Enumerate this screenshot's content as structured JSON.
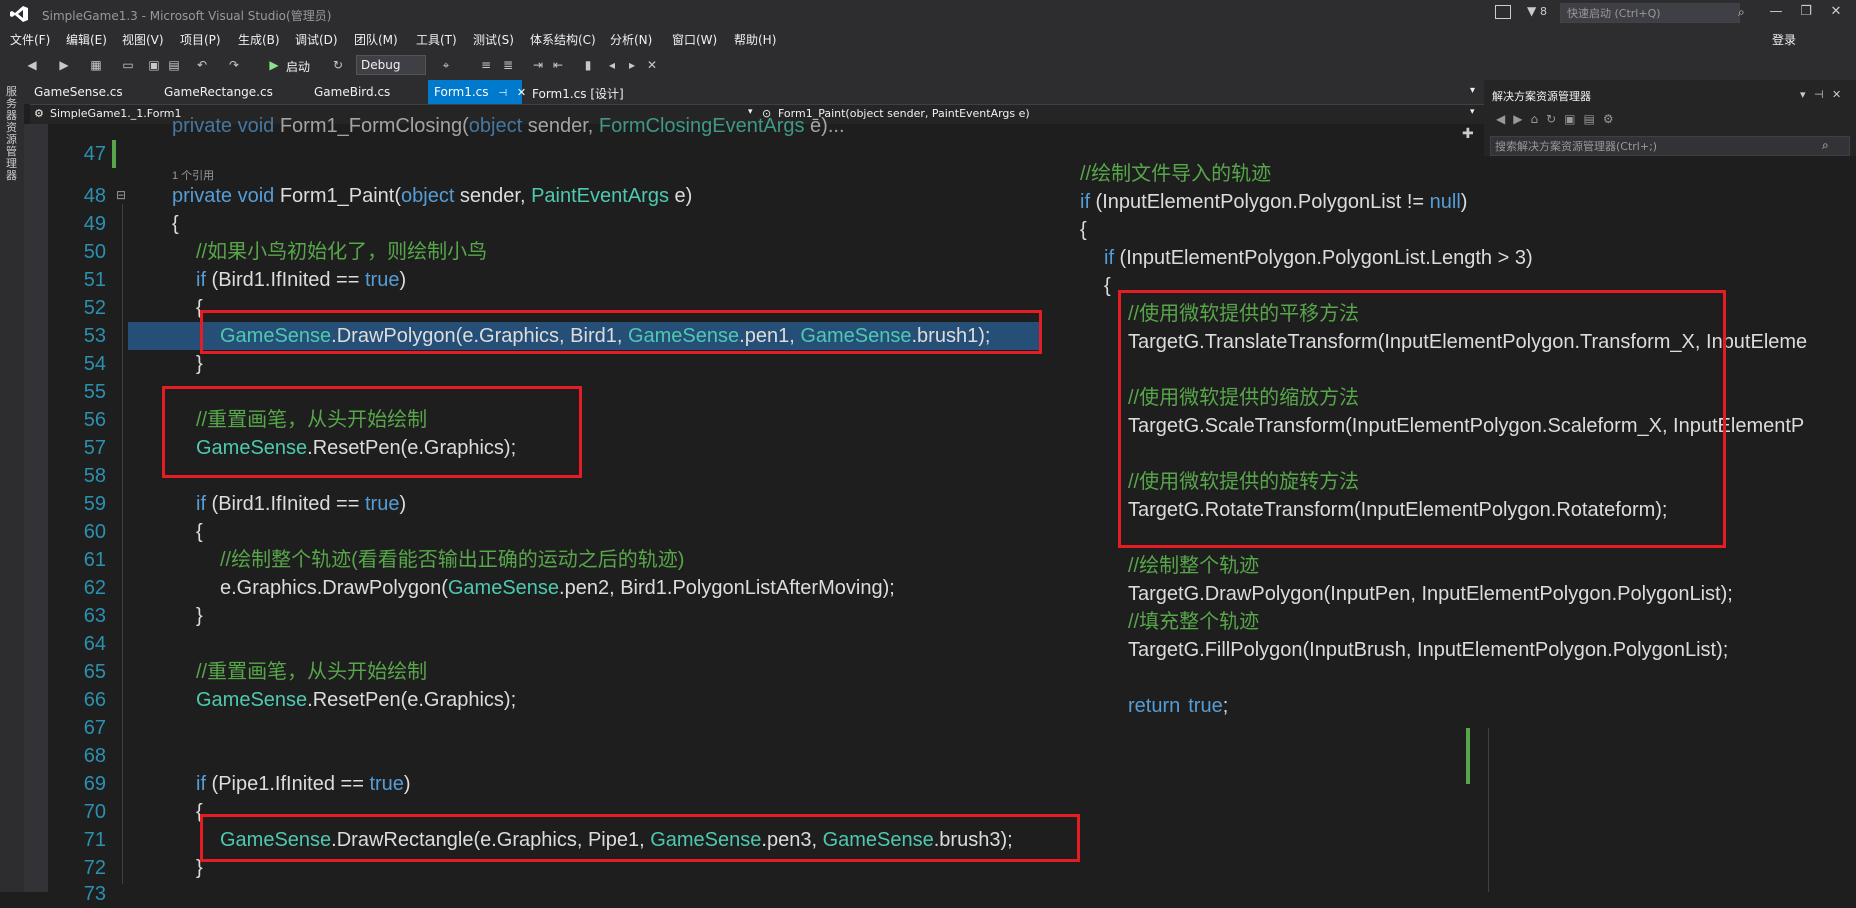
{
  "window": {
    "title": "SimpleGame1.3 - Microsoft Visual Studio(管理员)"
  },
  "title_right": {
    "notif": "8",
    "quick_launch": "快速启动 (Ctrl+Q)",
    "login": "登录"
  },
  "menu": [
    "文件(F)",
    "编辑(E)",
    "视图(V)",
    "项目(P)",
    "生成(B)",
    "调试(D)",
    "团队(M)",
    "工具(T)",
    "测试(S)",
    "体系结构(C)",
    "分析(N)",
    "窗口(W)",
    "帮助(H)"
  ],
  "toolbar": {
    "start": "启动",
    "config": "Debug"
  },
  "leftstrip": "服务器资源管理器",
  "tabs": [
    "GameSense.cs",
    "GameRectange.cs",
    "GameBird.cs",
    "Form1.cs",
    "Form1.cs [设计]"
  ],
  "navbar": {
    "left": "SimpleGame1._1.Form1",
    "right": "Form1_Paint(object sender, PaintEventArgs e)"
  },
  "solution": {
    "title": "解决方案资源管理器",
    "search": "搜索解决方案资源管理器(Ctrl+;)"
  },
  "line_numbers": [
    "47",
    "48",
    "49",
    "50",
    "51",
    "52",
    "53",
    "54",
    "55",
    "56",
    "57",
    "58",
    "59",
    "60",
    "61",
    "62",
    "63",
    "64",
    "65",
    "66",
    "67",
    "68",
    "69",
    "70",
    "71",
    "72",
    "73"
  ],
  "code": {
    "top_partial": {
      "kw": "private void ",
      "name": "Form1_FormClosing(",
      "kw2": "object",
      "rest": " sender, ",
      "ty": "FormClosingEventArgs",
      "end": " e)..."
    },
    "ref_count": "1 个引用",
    "l48": {
      "a": "private void",
      "b": " Form1_Paint(",
      "c": "object",
      "d": " sender, ",
      "e": "PaintEventArgs",
      "f": " e)"
    },
    "brace_open": "{",
    "brace_close": "}",
    "l50": "//如果小鸟初始化了，则绘制小鸟",
    "if_kw": "if",
    "true_kw": "true",
    "l51_mid": " (Bird1.IfInited == ",
    "l51_end": ")",
    "gs": "GameSense",
    "l53": {
      "a": ".DrawPolygon(e.Graphics, Bird1, ",
      "b": ".pen1, ",
      "c": ".brush1);"
    },
    "l56": "//重置画笔，从头开始绘制",
    "l57": ".ResetPen(e.Graphics);",
    "l61": "//绘制整个轨迹(看看能否输出正确的运动之后的轨迹)",
    "l62": {
      "a": "e.Graphics.DrawPolygon(",
      "b": ".pen2, Bird1.PolygonListAfterMoving);"
    },
    "l65": "//重置画笔，从头开始绘制",
    "l69_mid": " (Pipe1.IfInited == ",
    "l71": {
      "a": ".DrawRectangle(e.Graphics, Pipe1, ",
      "b": ".pen3, ",
      "c": ".brush3);"
    }
  },
  "overlay_code": {
    "c1": "//绘制文件导入的轨迹",
    "l2_mid": " (InputElementPolygon.PolygonList != ",
    "null_kw": "null",
    "l2_end": ")",
    "l4": " (InputElementPolygon.PolygonList.Length > 3)",
    "c_translate": "//使用微软提供的平移方法",
    "translate": "TargetG.TranslateTransform(InputElementPolygon.Transform_X, InputEleme",
    "c_scale": "//使用微软提供的缩放方法",
    "scale": "TargetG.ScaleTransform(InputElementPolygon.Scaleform_X, InputElementP",
    "c_rotate": "//使用微软提供的旋转方法",
    "rotate": "TargetG.RotateTransform(InputElementPolygon.Rotateform);",
    "c_draw": "//绘制整个轨迹",
    "draw": "TargetG.DrawPolygon(InputPen, InputElementPolygon.PolygonList);",
    "c_fill": "//填充整个轨迹",
    "fill": "TargetG.FillPolygon(InputBrush, InputElementPolygon.PolygonList);",
    "return_kw": "return",
    "return_end": ";"
  },
  "colors": {
    "keyword": "#569cd6",
    "type": "#4ec9b0",
    "comment": "#57a64a",
    "highlight": "#e51c23",
    "accent": "#007acc"
  }
}
